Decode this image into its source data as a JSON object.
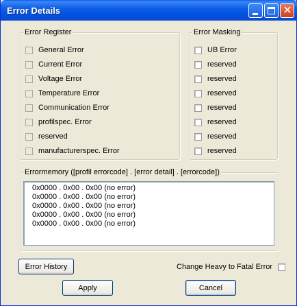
{
  "window": {
    "title": "Error Details"
  },
  "error_register": {
    "legend": "Error Register",
    "items": [
      "General Error",
      "Current Error",
      "Voltage Error",
      "Temperature Error",
      "Communication Error",
      "profilspec. Error",
      "reserved",
      "manufacturerspec. Error"
    ]
  },
  "error_masking": {
    "legend": "Error Masking",
    "items": [
      "UB Error",
      "reserved",
      "reserved",
      "reserved",
      "reserved",
      "reserved",
      "reserved",
      "reserved"
    ]
  },
  "error_memory": {
    "legend": "Errormemory ([profil errorcode] . [error detail] . [errorcode])",
    "entries": [
      "0x0000 . 0x00 . 0x00 (no error)",
      "0x0000 . 0x00 . 0x00 (no error)",
      "0x0000 . 0x00 . 0x00 (no error)",
      "0x0000 . 0x00 . 0x00 (no error)",
      "0x0000 . 0x00 . 0x00 (no error)"
    ]
  },
  "buttons": {
    "error_history": "Error History",
    "apply": "Apply",
    "cancel": "Cancel"
  },
  "options": {
    "change_heavy_to_fatal": "Change Heavy to Fatal Error"
  },
  "colors": {
    "titlebar": "#0a5de8",
    "window_bg": "#ece9d8",
    "list_border": "#7f9db9"
  }
}
